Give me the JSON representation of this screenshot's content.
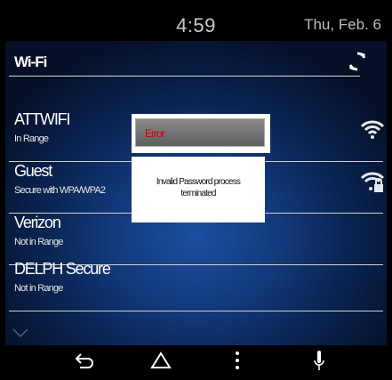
{
  "statusbar": {
    "time": "4:59",
    "date": "Thu, Feb. 6"
  },
  "header": {
    "title": "Wi-Fi"
  },
  "networks": [
    {
      "name": "ATTWIFI",
      "status": "In Range",
      "icon": "wifi-icon"
    },
    {
      "name": "Guest",
      "status": "Secure with WPA/WPA2",
      "icon": "wifi-lock-icon"
    },
    {
      "name": "Verizon",
      "status": "Not in Range"
    },
    {
      "name": "DELPH Secure",
      "status": "Not in Range"
    }
  ],
  "dialog": {
    "title": "Error",
    "message": "Invalid Password process terminated"
  },
  "colors": {
    "error_text": "#d40000",
    "background_accent": "#1c4fa0"
  }
}
